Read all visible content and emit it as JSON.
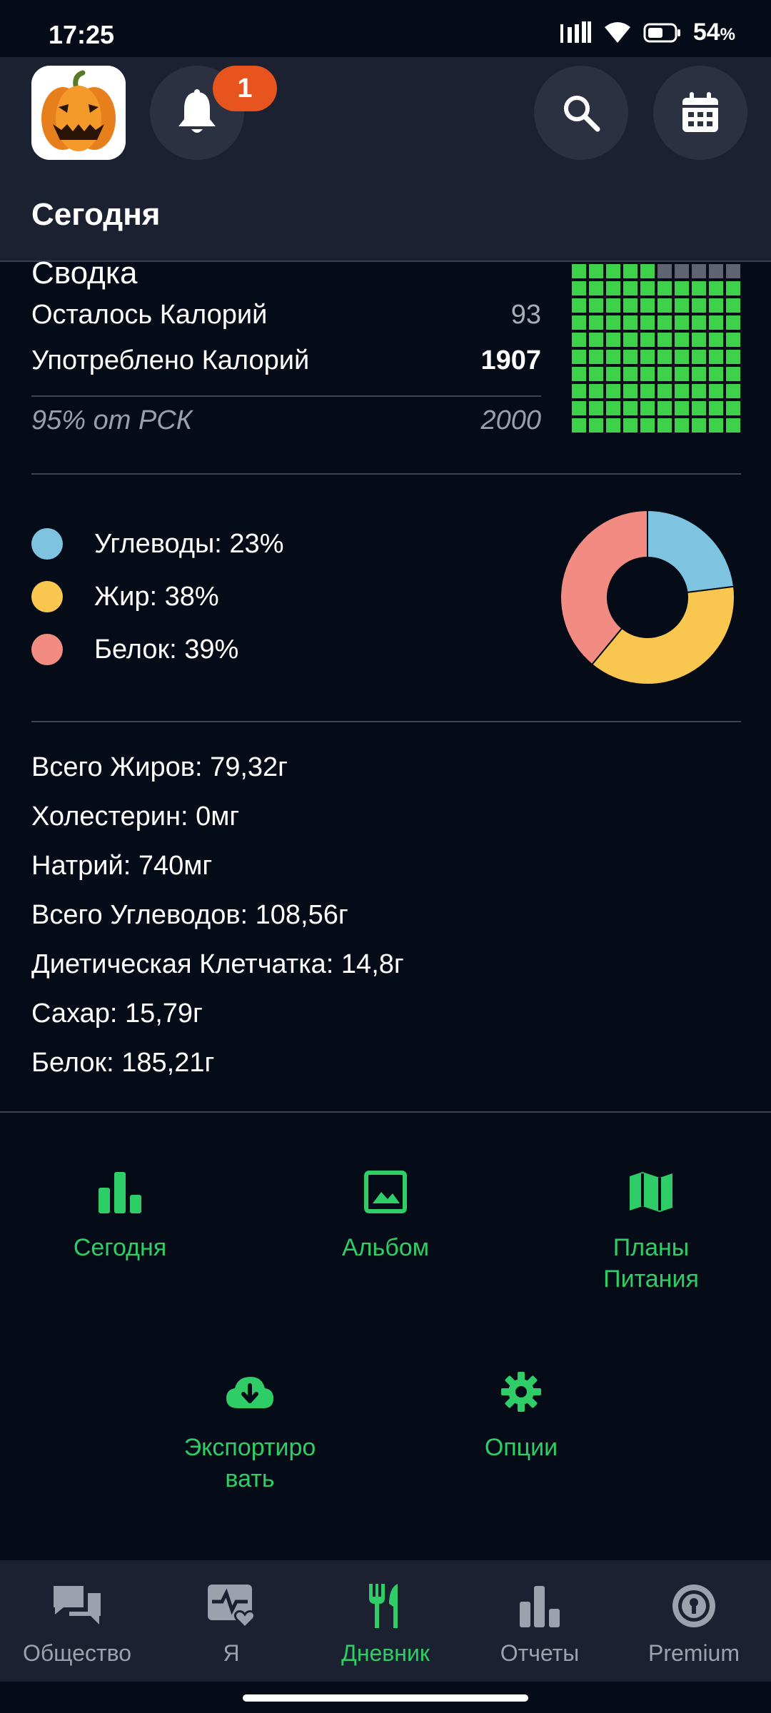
{
  "status_bar": {
    "time": "17:25",
    "battery": "54",
    "battery_unit": "%"
  },
  "header": {
    "notification_count": "1",
    "title": "Сегодня"
  },
  "summary": {
    "heading": "Сводка",
    "remaining_label": "Осталось Калорий",
    "remaining_value": "93",
    "consumed_label": "Употреблено Калорий",
    "consumed_value": "1907",
    "rsk_label": "95% от РСК",
    "rsk_value": "2000",
    "waffle_filled": 95,
    "waffle_total": 100
  },
  "macros": {
    "items": [
      {
        "label": "Углеводы: 23%",
        "color": "#7ec4e0",
        "percent": 23
      },
      {
        "label": "Жир: 38%",
        "color": "#f9c74f",
        "percent": 38
      },
      {
        "label": "Белок: 39%",
        "color": "#f28b82",
        "percent": 39
      }
    ]
  },
  "nutrients": [
    "Всего Жиров: 79,32г",
    "Холестерин: 0мг",
    "Натрий: 740мг",
    "Всего Углеводов: 108,56г",
    "Диетическая Клетчатка: 14,8г",
    "Сахар: 15,79г",
    "Белок: 185,21г"
  ],
  "actions": {
    "today": {
      "label": "Сегодня",
      "icon": "bar-chart-icon"
    },
    "album": {
      "label": "Альбом",
      "icon": "image-icon"
    },
    "plans": {
      "label": "Планы Питания",
      "icon": "map-icon"
    },
    "export": {
      "label": "Экспортиро вать",
      "icon": "cloud-download-icon"
    },
    "options": {
      "label": "Опции",
      "icon": "gear-icon"
    }
  },
  "bottom_nav": [
    {
      "label": "Общество",
      "icon": "chat-icon"
    },
    {
      "label": "Я",
      "icon": "heart-monitor-icon"
    },
    {
      "label": "Дневник",
      "icon": "fork-knife-icon",
      "active": true
    },
    {
      "label": "Отчеты",
      "icon": "bar-chart-icon"
    },
    {
      "label": "Premium",
      "icon": "premium-badge-icon"
    }
  ],
  "colors": {
    "accent": "#2fcd67",
    "waffle_on": "#3ed14a",
    "waffle_off": "#5f6470",
    "badge": "#e8541d"
  }
}
